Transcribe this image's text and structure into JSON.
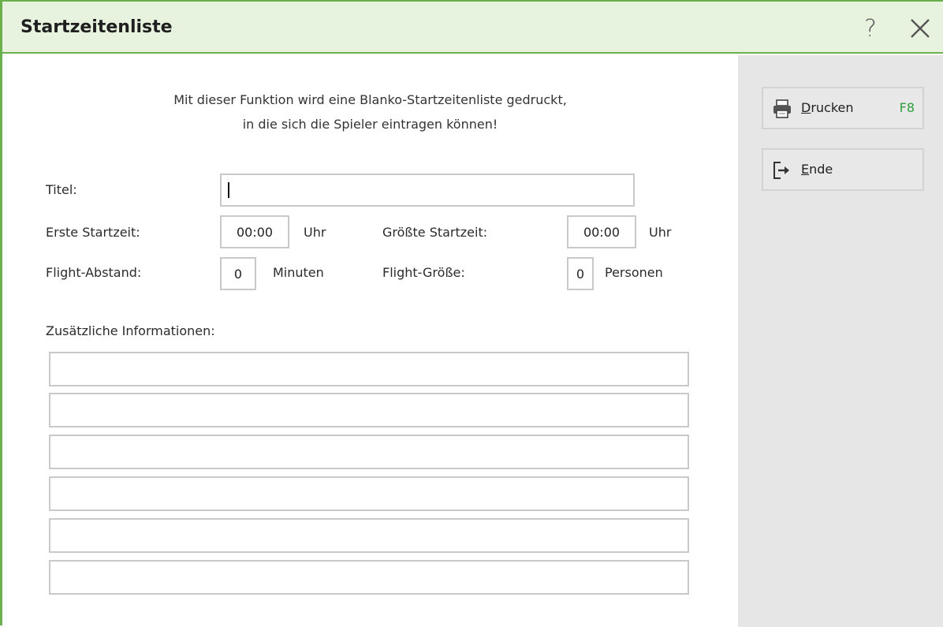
{
  "window": {
    "title": "Startzeitenliste",
    "help_label": "?"
  },
  "info": {
    "line1": "Mit dieser Funktion wird eine Blanko-Startzeitenliste gedruckt,",
    "line2": "in die sich die Spieler eintragen können!"
  },
  "form": {
    "title_label": "Titel:",
    "title_value": "",
    "first_start_label": "Erste Startzeit:",
    "first_start_value": "00:00",
    "first_start_unit": "Uhr",
    "last_start_label": "Größte Startzeit:",
    "last_start_value": "00:00",
    "last_start_unit": "Uhr",
    "flight_gap_label": "Flight-Abstand:",
    "flight_gap_value": "0",
    "flight_gap_unit": "Minuten",
    "flight_size_label": "Flight-Größe:",
    "flight_size_value": "0",
    "flight_size_unit": "Personen",
    "extra_info_label": "Zusätzliche Informationen:",
    "extra_info_lines": [
      "",
      "",
      "",
      "",
      "",
      ""
    ]
  },
  "actions": {
    "print": {
      "label_first": "D",
      "label_rest": "rucken",
      "shortcut": "F8",
      "icon": "printer-icon"
    },
    "end": {
      "label_first": "E",
      "label_rest": "nde",
      "icon": "exit-icon"
    }
  },
  "colors": {
    "accent": "#6ab04c",
    "titlebar_bg": "#e7f3df",
    "shortcut": "#2e9e3c",
    "side_panel": "#e6e6e6"
  }
}
